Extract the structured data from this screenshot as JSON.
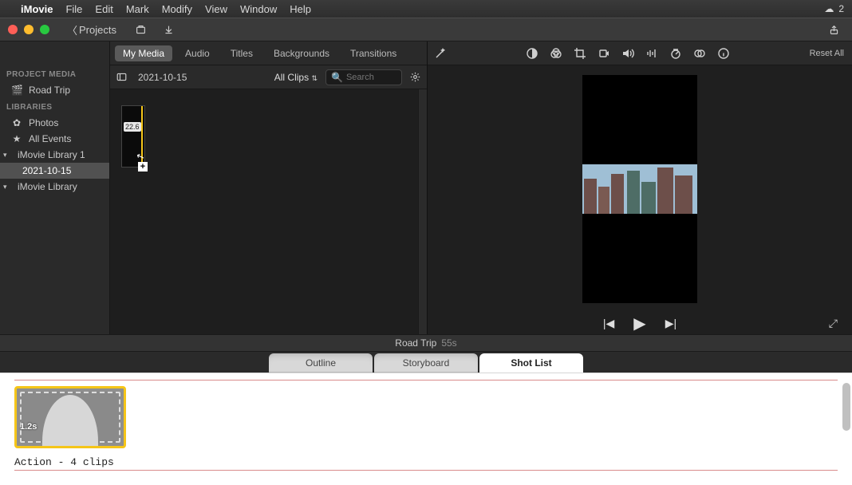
{
  "menubar": {
    "app": "iMovie",
    "items": [
      "File",
      "Edit",
      "Mark",
      "Modify",
      "View",
      "Window",
      "Help"
    ],
    "tray_count": "2"
  },
  "toolbar": {
    "back_label": "Projects"
  },
  "sidebar": {
    "project_media_header": "PROJECT MEDIA",
    "project_name": "Road Trip",
    "libraries_header": "LIBRARIES",
    "photos": "Photos",
    "all_events": "All Events",
    "lib1": "iMovie Library 1",
    "lib1_date": "2021-10-15",
    "lib2": "iMovie Library"
  },
  "mediatabs": {
    "my_media": "My Media",
    "audio": "Audio",
    "titles": "Titles",
    "backgrounds": "Backgrounds",
    "transitions": "Transitions"
  },
  "filterbar": {
    "date": "2021-10-15",
    "allclips": "All Clips",
    "search_placeholder": "Search"
  },
  "clip": {
    "duration_badge": "22.6"
  },
  "preview": {
    "reset": "Reset All",
    "caption": ""
  },
  "project": {
    "title": "Road Trip",
    "duration": "55s"
  },
  "shottabs": {
    "outline": "Outline",
    "storyboard": "Storyboard",
    "shotlist": "Shot List"
  },
  "shot": {
    "clip_duration": "1.2s",
    "caption": "Action - 4 clips"
  }
}
